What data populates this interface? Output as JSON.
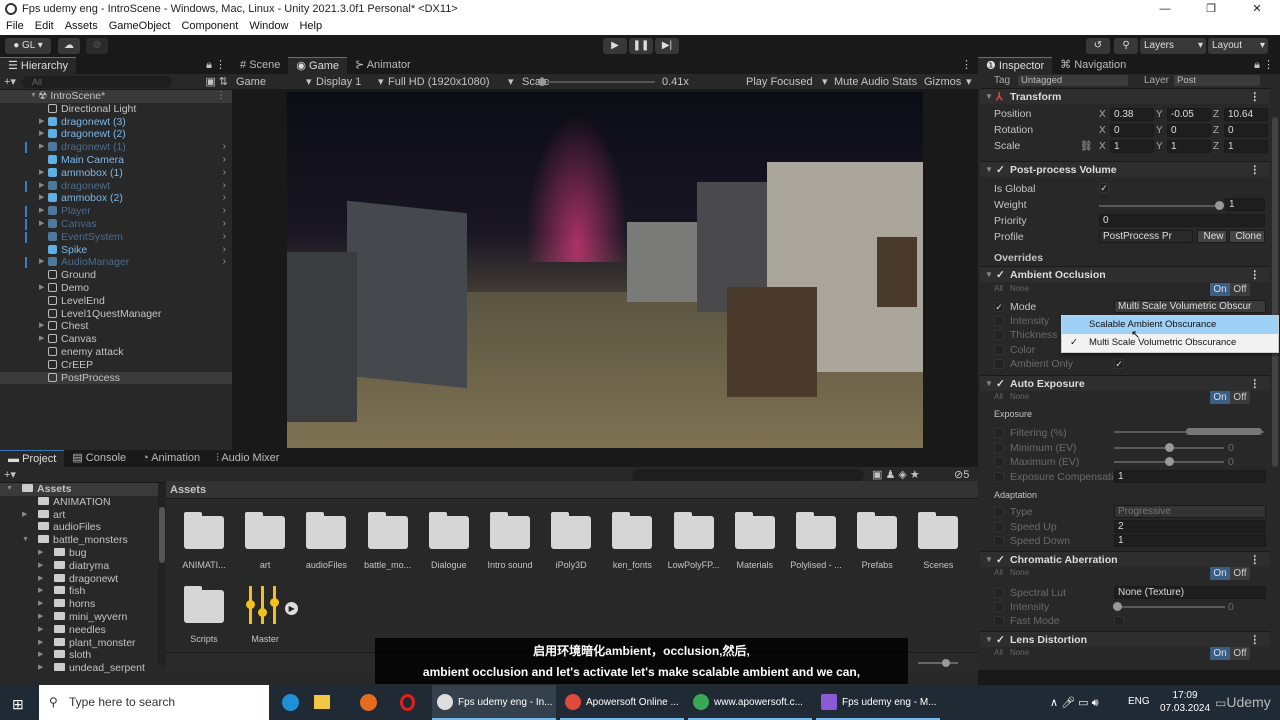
{
  "window": {
    "title": "Fps udemy eng - IntroScene - Windows, Mac, Linux - Unity 2021.3.0f1 Personal* <DX11>",
    "controls": [
      "—",
      "❐",
      "✕"
    ]
  },
  "menu": [
    "File",
    "Edit",
    "Assets",
    "GameObject",
    "Component",
    "Window",
    "Help"
  ],
  "toolbar": {
    "account": "GL ▾",
    "layers": "Layers",
    "layout": "Layout"
  },
  "hierarchy": {
    "tab": "Hierarchy",
    "search_placeholder": "All",
    "scene": "IntroScene*",
    "items": [
      {
        "label": "Directional Light",
        "type": "object",
        "expand": false
      },
      {
        "label": "dragonewt (3)",
        "type": "prefab",
        "expand": true
      },
      {
        "label": "dragonewt (2)",
        "type": "prefab",
        "expand": true
      },
      {
        "label": "dragonewt (1)",
        "type": "faded",
        "expand": true,
        "chev": true
      },
      {
        "label": "Main Camera",
        "type": "prefab",
        "expand": false,
        "chev": true
      },
      {
        "label": "ammobox (1)",
        "type": "prefab",
        "expand": true,
        "chev": true
      },
      {
        "label": "dragonewt",
        "type": "faded",
        "expand": true,
        "chev": true
      },
      {
        "label": "ammobox (2)",
        "type": "prefab",
        "expand": true,
        "chev": true
      },
      {
        "label": "Player",
        "type": "faded",
        "expand": true,
        "chev": true
      },
      {
        "label": "Canvas",
        "type": "faded",
        "expand": true,
        "chev": true
      },
      {
        "label": "EventSystem",
        "type": "faded",
        "expand": false,
        "chev": true
      },
      {
        "label": "Spike",
        "type": "prefab",
        "expand": false,
        "chev": true
      },
      {
        "label": "AudioManager",
        "type": "faded",
        "expand": true,
        "chev": true
      },
      {
        "label": "Ground",
        "type": "object",
        "expand": false
      },
      {
        "label": "Demo",
        "type": "object",
        "expand": true
      },
      {
        "label": "LevelEnd",
        "type": "object",
        "expand": false
      },
      {
        "label": "Level1QuestManager",
        "type": "object",
        "expand": false
      },
      {
        "label": "Chest",
        "type": "object",
        "expand": true
      },
      {
        "label": "Canvas",
        "type": "object",
        "expand": true
      },
      {
        "label": "enemy attack",
        "type": "object",
        "expand": false
      },
      {
        "label": "CrEEP",
        "type": "object",
        "expand": false
      },
      {
        "label": "PostProcess",
        "type": "object",
        "expand": false,
        "selected": true
      }
    ]
  },
  "game": {
    "tabs": [
      "Scene",
      "Game",
      "Animator"
    ],
    "active_tab": "Game",
    "view": "Game",
    "display": "Display 1",
    "resolution": "Full HD (1920x1080)",
    "scale_label": "Scale",
    "scale_value": "0.41x",
    "play_focused": "Play Focused",
    "mute_audio": "Mute Audio",
    "stats": "Stats",
    "gizmos": "Gizmos"
  },
  "project": {
    "tabs": [
      "Project",
      "Console",
      "Animation",
      "Audio Mixer"
    ],
    "active_tab": "Project",
    "breadcrumb": "Assets",
    "hidden_count": "5",
    "tree": [
      {
        "label": "Assets",
        "depth": 0,
        "expand": "open"
      },
      {
        "label": "ANIMATION",
        "depth": 1,
        "expand": ""
      },
      {
        "label": "art",
        "depth": 1,
        "expand": "closed"
      },
      {
        "label": "audioFiles",
        "depth": 1,
        "expand": ""
      },
      {
        "label": "battle_monsters",
        "depth": 1,
        "expand": "open"
      },
      {
        "label": "bug",
        "depth": 2,
        "expand": "closed"
      },
      {
        "label": "diatryma",
        "depth": 2,
        "expand": "closed"
      },
      {
        "label": "dragonewt",
        "depth": 2,
        "expand": "closed"
      },
      {
        "label": "fish",
        "depth": 2,
        "expand": "closed"
      },
      {
        "label": "horns",
        "depth": 2,
        "expand": "closed"
      },
      {
        "label": "mini_wyvern",
        "depth": 2,
        "expand": "closed"
      },
      {
        "label": "needles",
        "depth": 2,
        "expand": "closed"
      },
      {
        "label": "plant_monster",
        "depth": 2,
        "expand": "closed"
      },
      {
        "label": "sloth",
        "depth": 2,
        "expand": "closed"
      },
      {
        "label": "undead_serpent",
        "depth": 2,
        "expand": "closed"
      }
    ],
    "assets": [
      "ANIMATI...",
      "art",
      "audioFiles",
      "battle_mo...",
      "Dialogue",
      "Intro sound",
      "iPoly3D",
      "ken_fonts",
      "LowPolyFP...",
      "Materials",
      "Polylised - ...",
      "Prefabs",
      "Scenes",
      "Scripts",
      "Master"
    ]
  },
  "inspector": {
    "tabs": [
      "Inspector",
      "Navigation"
    ],
    "tag_label": "Tag",
    "tag": "Untagged",
    "layer_label": "Layer",
    "layer": "Post",
    "transform": {
      "title": "Transform",
      "rows": [
        {
          "label": "Position",
          "x": "0.38",
          "y": "-0.05",
          "z": "10.64"
        },
        {
          "label": "Rotation",
          "x": "0",
          "y": "0",
          "z": "0"
        },
        {
          "label": "Scale",
          "x": "1",
          "y": "1",
          "z": "1"
        }
      ]
    },
    "ppv": {
      "title": "Post-process Volume",
      "is_global": "Is Global",
      "weight_label": "Weight",
      "weight": "1",
      "weight_fraction": 1,
      "priority_label": "Priority",
      "priority": "0",
      "profile_label": "Profile",
      "profile": "PostProcess Pr",
      "new": "New",
      "clone": "Clone",
      "overrides": "Overrides"
    },
    "all": "All",
    "none": "None",
    "on": "On",
    "off": "Off",
    "ao": {
      "title": "Ambient Occlusion",
      "mode_label": "Mode",
      "mode": "Multi Scale Volumetric Obscur",
      "intensity": "Intensity",
      "thickness": "Thickness",
      "color": "Color",
      "ambient_only": "Ambient Only"
    },
    "dropdown": [
      "Scalable Ambient Obscurance",
      "Multi Scale Volumetric Obscurance"
    ],
    "ae": {
      "title": "Auto Exposure",
      "exposure": "Exposure",
      "filtering": "Filtering (%)",
      "minimum": "Minimum (EV)",
      "min_val": "0",
      "maximum": "Maximum (EV)",
      "max_val": "0",
      "comp": "Exposure Compensatio",
      "comp_val": "1",
      "adaptation": "Adaptation",
      "type": "Type",
      "type_val": "Progressive",
      "speed_up": "Speed Up",
      "speed_up_val": "2",
      "speed_down": "Speed Down",
      "speed_down_val": "1"
    },
    "ca": {
      "title": "Chromatic Aberration",
      "lut": "Spectral Lut",
      "lut_val": "None (Texture)",
      "intensity": "Intensity",
      "intensity_val": "0",
      "fast": "Fast Mode"
    },
    "ld": {
      "title": "Lens Distortion"
    }
  },
  "subtitles": [
    "启用环境暗化ambient，occlusion,然后,",
    "ambient occlusion and let's activate let's make scalable ambient and we can,"
  ],
  "taskbar": {
    "search": "Type here to search",
    "apps": [
      "Fps udemy eng - In...",
      "Apowersoft Online ...",
      "www.apowersoft.c...",
      "Fps udemy eng - M..."
    ],
    "lang": "ENG",
    "time": "17:09",
    "date": "07.03.2024",
    "watermark": "Udemy"
  }
}
